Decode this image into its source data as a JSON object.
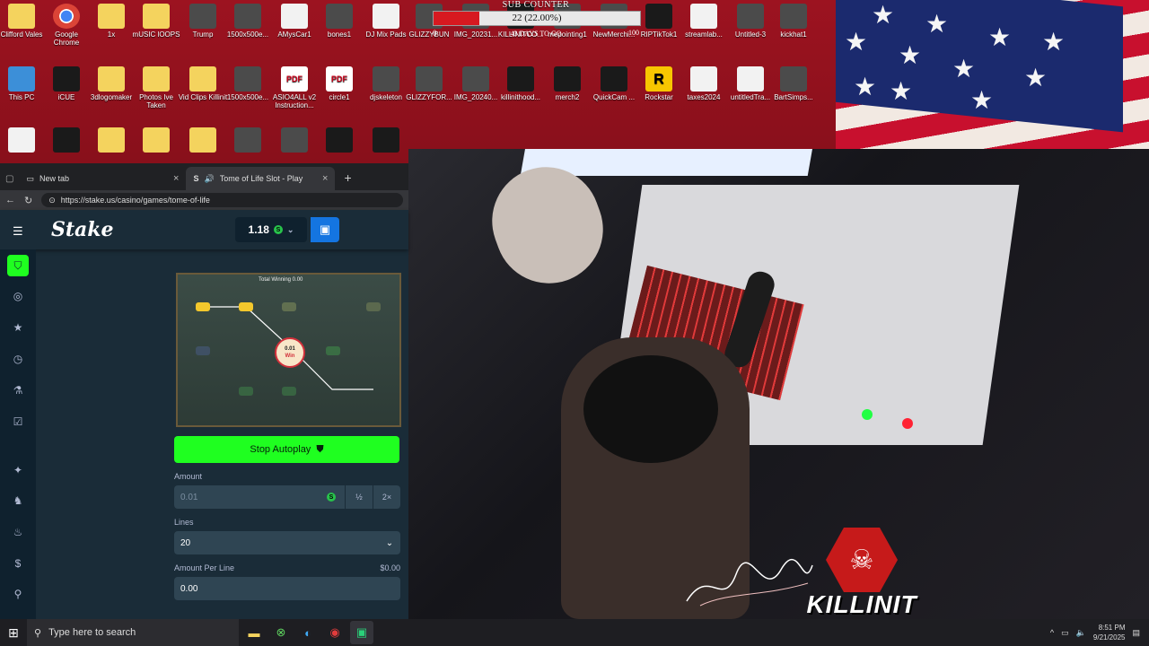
{
  "desktop": {
    "icons": [
      {
        "label": "Clifford Vales",
        "glyph": "",
        "kind": "g-folder"
      },
      {
        "label": "Google Chrome",
        "glyph": "",
        "kind": "g-chrome"
      },
      {
        "label": "1x",
        "glyph": "",
        "kind": "g-folder"
      },
      {
        "label": "mUSIC lOOPS",
        "glyph": "",
        "kind": "g-folder"
      },
      {
        "label": "Trump",
        "glyph": "",
        "kind": "g-img"
      },
      {
        "label": "1500x500e...",
        "glyph": "",
        "kind": "g-img"
      },
      {
        "label": "AMysCar1",
        "glyph": "",
        "kind": "g-doc"
      },
      {
        "label": "bones1",
        "glyph": "",
        "kind": "g-img"
      },
      {
        "label": "DJ Mix Pads",
        "glyph": "",
        "kind": "g-doc"
      },
      {
        "label": "GLIZZYBUN",
        "glyph": "",
        "kind": "g-img"
      },
      {
        "label": "IMG_20231...",
        "glyph": "",
        "kind": "g-img"
      },
      {
        "label": "KILLINITCO...",
        "glyph": "",
        "kind": "g-dark"
      },
      {
        "label": "mepointing1",
        "glyph": "",
        "kind": "g-img"
      },
      {
        "label": "NewMerchi...",
        "glyph": "",
        "kind": "g-img"
      },
      {
        "label": "RIPTikTok1",
        "glyph": "",
        "kind": "g-dark"
      },
      {
        "label": "streamlab...",
        "glyph": "",
        "kind": "g-doc"
      },
      {
        "label": "Untitled-3",
        "glyph": "",
        "kind": "g-img"
      },
      {
        "label": "kickhat1",
        "glyph": "",
        "kind": "g-img"
      },
      {
        "label": "This PC",
        "glyph": "",
        "kind": "g-pc"
      },
      {
        "label": "iCUE",
        "glyph": "",
        "kind": "g-dark"
      },
      {
        "label": "3dlogomaker",
        "glyph": "",
        "kind": "g-folder"
      },
      {
        "label": "Photos Ive Taken",
        "glyph": "",
        "kind": "g-folder"
      },
      {
        "label": "Vid Clips Killinit",
        "glyph": "",
        "kind": "g-folder"
      },
      {
        "label": "1500x500e...",
        "glyph": "",
        "kind": "g-img"
      },
      {
        "label": "ASIO4ALL v2 Instruction...",
        "glyph": "PDF",
        "kind": "g-pdf"
      },
      {
        "label": "circle1",
        "glyph": "PDF",
        "kind": "g-pdf"
      },
      {
        "label": "djskeleton",
        "glyph": "",
        "kind": "g-img"
      },
      {
        "label": "GLIZZYFOR...",
        "glyph": "",
        "kind": "g-img"
      },
      {
        "label": "IMG_20240...",
        "glyph": "",
        "kind": "g-img"
      },
      {
        "label": "killinithood...",
        "glyph": "",
        "kind": "g-dark"
      },
      {
        "label": "merch2",
        "glyph": "",
        "kind": "g-dark"
      },
      {
        "label": "QuickCam ...",
        "glyph": "",
        "kind": "g-dark"
      },
      {
        "label": "Rockstar",
        "glyph": "R",
        "kind": "g-rock"
      },
      {
        "label": "taxes2024",
        "glyph": "",
        "kind": "g-doc"
      },
      {
        "label": "untitledTra...",
        "glyph": "",
        "kind": "g-doc"
      },
      {
        "label": "BartSimps...",
        "glyph": "",
        "kind": "g-img"
      }
    ],
    "row3_icons": [
      {
        "kind": "g-doc"
      },
      {
        "kind": "g-dark"
      },
      {
        "kind": "g-folder"
      },
      {
        "kind": "g-folder"
      },
      {
        "kind": "g-folder"
      },
      {
        "kind": "g-img"
      },
      {
        "kind": "g-img"
      },
      {
        "kind": "g-dark"
      },
      {
        "kind": "g-dark"
      }
    ]
  },
  "sub_counter": {
    "title": "SUB COUNTER",
    "value_text": "22 (22.00%)",
    "progress_percent": 22,
    "min_label": "0",
    "max_label": "100",
    "days_text": "43 DAYS TO GO"
  },
  "browser": {
    "tabs": [
      {
        "label": "New tab"
      },
      {
        "label": "Tome of Life Slot - Play Slot..."
      }
    ],
    "url": "https://stake.us/casino/games/tome-of-life"
  },
  "stake": {
    "logo": "Stake",
    "balance": "1.18",
    "coin_symbol": "S",
    "game": {
      "total_winning": "Total Winning 0.00",
      "win_badge": "0.01",
      "win_label": "Win"
    },
    "autoplay_button": "Stop Autoplay",
    "amount_label": "Amount",
    "amount_value": "0.01",
    "half_label": "½",
    "double_label": "2×",
    "lines_label": "Lines",
    "lines_value": "20",
    "amount_per_line_label": "Amount Per Line",
    "amount_per_line_usd": "$0.00",
    "amount_per_line_value": "0.00"
  },
  "branding": {
    "logo_text": "KILLINIT"
  },
  "taskbar": {
    "search_placeholder": "Type here to search",
    "time": "8:51 PM",
    "date": "9/21/2025"
  },
  "colors": {
    "stake_green": "#1fff20",
    "stake_bg": "#1a2c38",
    "wallet_blue": "#1475e1",
    "sub_red": "#d71920"
  }
}
